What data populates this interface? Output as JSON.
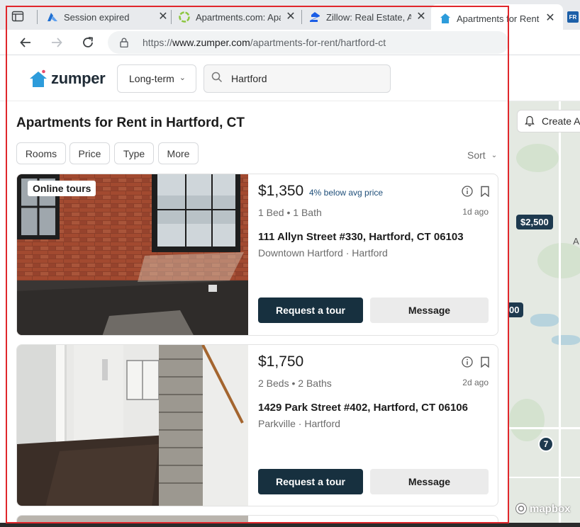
{
  "browser": {
    "tabs": [
      {
        "title": "Session expired",
        "icon": "azure-icon"
      },
      {
        "title": "Apartments.com: Apar",
        "icon": "apartments-com-icon"
      },
      {
        "title": "Zillow: Real Estate, Ap",
        "icon": "zillow-icon"
      },
      {
        "title": "Apartments for Rent In",
        "icon": "zumper-icon",
        "active": true
      },
      {
        "title": "FR",
        "icon": "fr-icon"
      }
    ],
    "close_glyph": "✕",
    "url_prefix": "https://",
    "url_domain": "www.zumper.com",
    "url_path": "/apartments-for-rent/hartford-ct"
  },
  "header": {
    "brand": "zumper",
    "term_select": "Long-term",
    "search_value": "Hartford"
  },
  "listing_page": {
    "title": "Apartments for Rent in Hartford, CT",
    "filters": [
      "Rooms",
      "Price",
      "Type",
      "More"
    ],
    "sort_label": "Sort"
  },
  "listings": [
    {
      "badge": "Online tours",
      "price": "$1,350",
      "deal": "4% below avg price",
      "beds_baths": "1 Bed • 1 Bath",
      "age": "1d ago",
      "address": "111 Allyn Street #330, Hartford, CT 06103",
      "neighborhood": "Downtown Hartford · Hartford",
      "tour_label": "Request a tour",
      "message_label": "Message"
    },
    {
      "badge": "",
      "price": "$1,750",
      "deal": "",
      "beds_baths": "2 Beds • 2 Baths",
      "age": "2d ago",
      "address": "1429 Park Street #402, Hartford, CT 06106",
      "neighborhood": "Parkville · Hartford",
      "tour_label": "Request a tour",
      "message_label": "Message"
    }
  ],
  "map": {
    "create_alert": "Create A",
    "pins": [
      "$2,500",
      "00"
    ],
    "clusters": [
      "7"
    ],
    "edge_label": "A",
    "attribution": "mapbox"
  },
  "colors": {
    "primary_dark": "#17303f",
    "brand_blue": "#2d9cdb",
    "highlight_red": "#e0262b"
  }
}
